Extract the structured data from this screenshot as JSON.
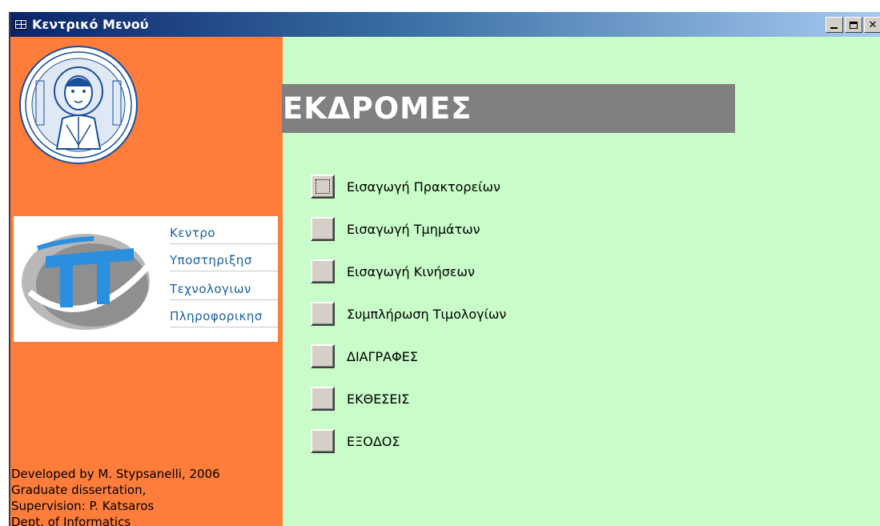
{
  "window": {
    "title": "Κεντρικό Μενού"
  },
  "left_panel": {
    "logo_words": [
      "Κεντρο",
      "Υποστηριξησ",
      "Τεχνολογιων",
      "Πληροφορικησ"
    ],
    "credits": [
      "Developed by M. Stypsanelli, 2006",
      "Graduate dissertation,",
      "Supervision: P. Katsaros",
      "Dept. of Informatics"
    ]
  },
  "main": {
    "heading": "ΕΚΔΡΟΜΕΣ",
    "menu": [
      {
        "label": "Εισαγωγή Πρακτορείων",
        "focused": true
      },
      {
        "label": "Εισαγωγή Τμημάτων",
        "focused": false
      },
      {
        "label": "Εισαγωγή Κινήσεων",
        "focused": false
      },
      {
        "label": "Συμπλήρωση Τιμολογίων",
        "focused": false
      },
      {
        "label": "ΔΙΑΓΡΑΦΕΣ",
        "focused": false
      },
      {
        "label": "ΕΚΘΕΣΕΙΣ",
        "focused": false
      },
      {
        "label": "ΕΞΟΔΟΣ",
        "focused": false
      }
    ]
  },
  "colors": {
    "titlebar": "#0a246a",
    "left_panel": "#ff7d3a",
    "main_background": "#c8fcc8",
    "heading_bar": "#808080",
    "seal_blue": "#1a4f9a",
    "logo_blue": "#1a5fa6"
  },
  "icons": {
    "window_icon": "form-icon",
    "minimize": "minimize-icon",
    "maximize": "maximize-icon",
    "close": "close-icon"
  }
}
